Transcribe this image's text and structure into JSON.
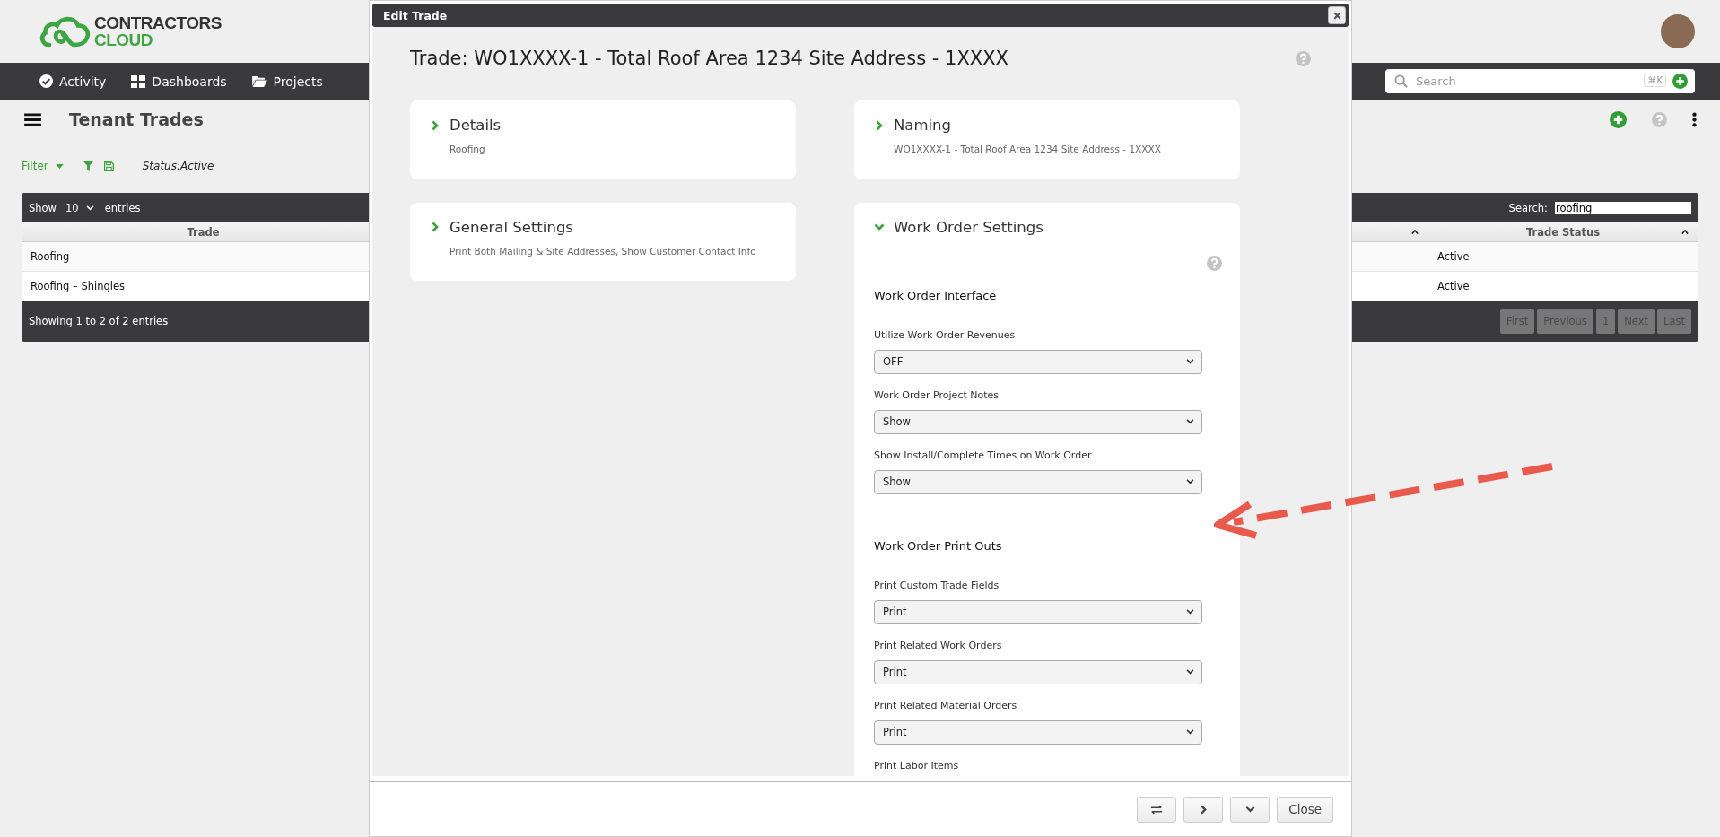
{
  "logo": {
    "line1": "CONTRACTORS",
    "line2": "CLOUD"
  },
  "nav": {
    "items": [
      {
        "label": "Activity",
        "kind": "activity"
      },
      {
        "label": "Dashboards",
        "kind": "dashboards"
      },
      {
        "label": "Projects",
        "kind": "projects"
      }
    ],
    "search": {
      "placeholder": "Search",
      "shortcut": "⌘K"
    }
  },
  "page": {
    "title": "Tenant Trades",
    "filter": {
      "label": "Filter",
      "status": "Status:Active"
    }
  },
  "table": {
    "length": {
      "label_before": "Show",
      "value": "10",
      "label_after": "entries"
    },
    "search": {
      "label": "Search:",
      "value": "roofing"
    },
    "columns": [
      {
        "label": "Trade"
      },
      {
        "sortable": true
      },
      {
        "label": "Trade Status",
        "sortable": true
      }
    ],
    "rows": [
      {
        "trade": "Roofing",
        "status": "Active"
      },
      {
        "trade": "Roofing – Shingles",
        "status": "Active"
      }
    ],
    "info": "Showing 1 to 2 of 2 entries",
    "pagination": [
      {
        "label": "First",
        "disabled": true
      },
      {
        "label": "Previous",
        "disabled": true
      },
      {
        "label": "1",
        "disabled": true
      },
      {
        "label": "Next",
        "disabled": true
      },
      {
        "label": "Last",
        "disabled": true
      }
    ]
  },
  "modal": {
    "title": "Edit Trade",
    "heading": "Trade: WO1XXXX-1 - Total Roof Area 1234 Site Address - 1XXXX",
    "left_cards": [
      {
        "title": "Details",
        "summary": "Roofing",
        "expanded": false
      },
      {
        "title": "General Settings",
        "summary": "Print Both Mailing & Site Addresses, Show Customer Contact Info",
        "expanded": false
      }
    ],
    "right_cards": [
      {
        "title": "Naming",
        "summary": "WO1XXXX-1 - Total Roof Area 1234 Site Address - 1XXXX",
        "expanded": false
      },
      {
        "title": "Work Order Settings",
        "expanded": true,
        "sections": [
          {
            "heading": "Work Order Interface",
            "fields": [
              {
                "label": "Utilize Work Order Revenues",
                "value": "OFF"
              },
              {
                "label": "Work Order Project Notes",
                "value": "Show"
              },
              {
                "label": "Show Install/Complete Times on Work Order",
                "value": "Show"
              }
            ]
          },
          {
            "heading": "Work Order Print Outs",
            "fields": [
              {
                "label": "Print Custom Trade Fields",
                "value": "Print"
              },
              {
                "label": "Print Related Work Orders",
                "value": "Print"
              },
              {
                "label": "Print Related Material Orders",
                "value": "Print"
              },
              {
                "label": "Print Labor Items"
              }
            ]
          }
        ]
      }
    ],
    "footer_buttons": [
      {
        "kind": "swap"
      },
      {
        "kind": "next"
      },
      {
        "kind": "expand"
      },
      {
        "kind": "text",
        "label": "Close"
      }
    ]
  }
}
